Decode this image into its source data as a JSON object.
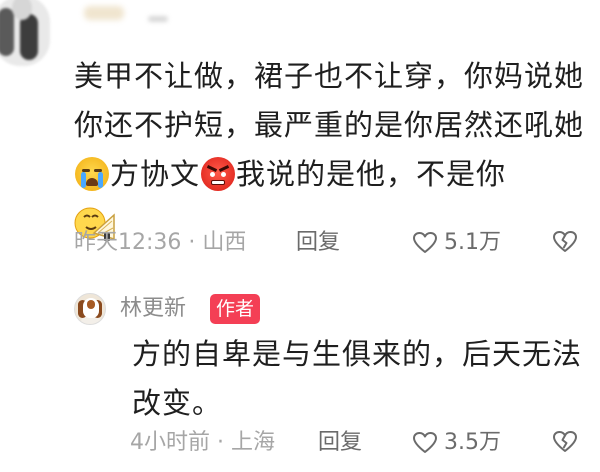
{
  "comment": {
    "segments": [
      "美甲不让做，裙子也不让穿，你妈说她你还不护短，最严重的是你居然还吼她",
      "方协文",
      "我说的是他，不是你"
    ],
    "emojis": [
      "crying-face-icon",
      "angry-face-icon",
      "hand-fan-sticker-icon"
    ],
    "time": "昨天12:36",
    "separator": "·",
    "location": "山西",
    "reply_label": "回复",
    "likes": "5.1万"
  },
  "reply": {
    "author": "林更新",
    "badge": "作者",
    "text": "方的自卑是与生俱来的，后天无法改变。",
    "time": "4小时前",
    "separator": "·",
    "location": "上海",
    "reply_label": "回复",
    "likes": "3.5万"
  },
  "colors": {
    "badge": "#f43f55",
    "meta": "#a6a6a6",
    "text": "#1f1f1f"
  }
}
